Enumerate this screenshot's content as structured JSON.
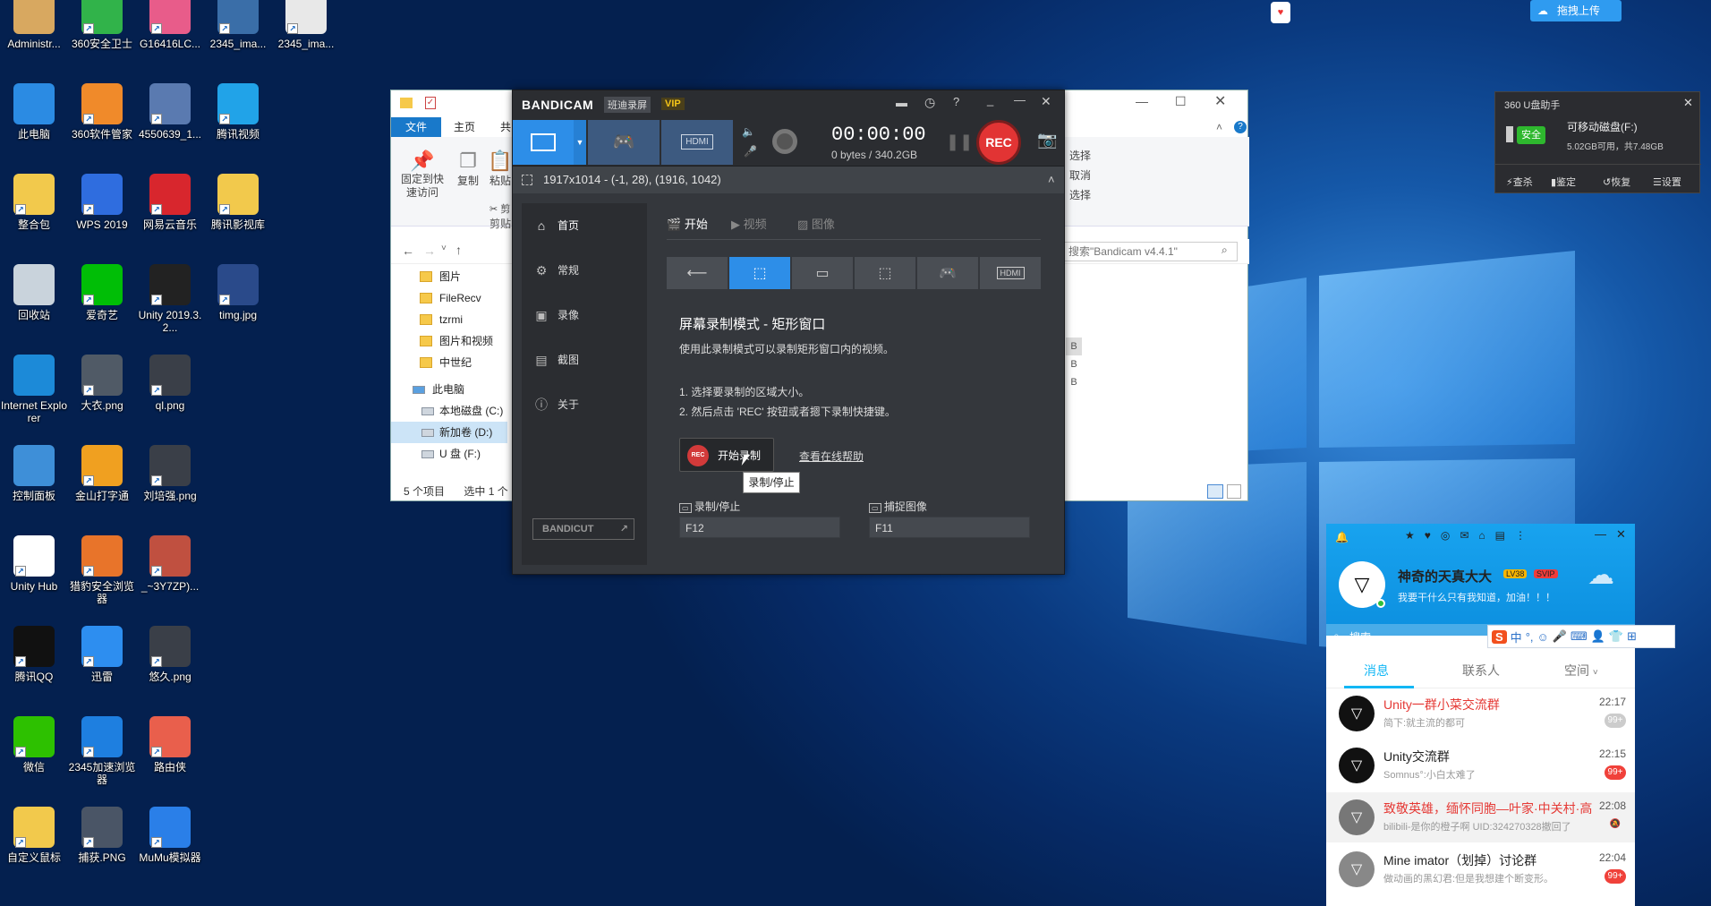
{
  "desktop": {
    "icons": [
      {
        "label": "Administr...",
        "color": "#d8a860"
      },
      {
        "label": "360安全卫士",
        "color": "#31b34a"
      },
      {
        "label": "G16416LC...",
        "color": "#e85c8a"
      },
      {
        "label": "2345_ima...",
        "color": "#3a6ea8"
      },
      {
        "label": "2345_ima...",
        "color": "#e8e8e8"
      },
      {
        "label": "此电脑",
        "color": "#2b8be3"
      },
      {
        "label": "360软件管家",
        "color": "#f08a2a"
      },
      {
        "label": "4550639_1...",
        "color": "#5a7ab0"
      },
      {
        "label": "腾讯视频",
        "color": "#21a3e8"
      },
      {
        "label": "整合包",
        "color": "#f2c94c"
      },
      {
        "label": "WPS 2019",
        "color": "#2f6ddf"
      },
      {
        "label": "网易云音乐",
        "color": "#d8262d"
      },
      {
        "label": "腾讯影视库",
        "color": "#f2c94c"
      },
      {
        "label": "回收站",
        "color": "#c9d3dc"
      },
      {
        "label": "爱奇艺",
        "color": "#00be06"
      },
      {
        "label": "Unity 2019.3.2...",
        "color": "#222222"
      },
      {
        "label": "timg.jpg",
        "color": "#2a4a8a"
      },
      {
        "label": "Internet Explorer",
        "color": "#1c8ad8"
      },
      {
        "label": "大衣.png",
        "color": "#505a66"
      },
      {
        "label": "ql.png",
        "color": "#3a3f48"
      },
      {
        "label": "控制面板",
        "color": "#3e8fd8"
      },
      {
        "label": "金山打字通",
        "color": "#f0a020"
      },
      {
        "label": "刘培强.png",
        "color": "#3a3f48"
      },
      {
        "label": "Unity Hub",
        "color": "#ffffff"
      },
      {
        "label": "猎豹安全浏览器",
        "color": "#e8742a"
      },
      {
        "label": "_~3Y7ZP)...",
        "color": "#c05040"
      },
      {
        "label": "腾讯QQ",
        "color": "#111111"
      },
      {
        "label": "迅雷",
        "color": "#2d8ef0"
      },
      {
        "label": "悠久.png",
        "color": "#3a3f48"
      },
      {
        "label": "微信",
        "color": "#2dc100"
      },
      {
        "label": "2345加速浏览器",
        "color": "#1e7fe0"
      },
      {
        "label": "路由侠",
        "color": "#e95f4c"
      },
      {
        "label": "自定义鼠标",
        "color": "#f2c94c"
      },
      {
        "label": "捕获.PNG",
        "color": "#4a5566"
      },
      {
        "label": "MuMu模拟器",
        "color": "#2a7fe8"
      }
    ],
    "upload_button": "拖拽上传"
  },
  "explorer": {
    "tab_file": "文件",
    "tab_home": "主页",
    "tab_share": "共",
    "ribbon": {
      "pin": "固定到快速访问",
      "copy": "复制",
      "paste": "粘贴",
      "cut": "剪",
      "clip": "剪贴",
      "select_all": "选择",
      "cancel_sel": "取消",
      "invert_sel": "选择"
    },
    "search_placeholder": "搜索\"Bandicam v4.4.1\"",
    "tree": [
      {
        "label": "图片",
        "type": "pic"
      },
      {
        "label": "FileRecv",
        "type": "folder"
      },
      {
        "label": "tzrmi",
        "type": "folder"
      },
      {
        "label": "图片和视频",
        "type": "folder"
      },
      {
        "label": "中世纪",
        "type": "folder"
      },
      {
        "label": "此电脑",
        "type": "pc"
      },
      {
        "label": "本地磁盘 (C:)",
        "type": "drive"
      },
      {
        "label": "新加卷 (D:)",
        "type": "drive"
      },
      {
        "label": "U 盘 (F:)",
        "type": "drive"
      }
    ],
    "sizes": [
      "B",
      "B",
      "B"
    ],
    "status_items": "5 个项目",
    "status_selected": "选中 1 个"
  },
  "bandicam": {
    "logo": "BANDICAM",
    "subtitle": "班迪录屏",
    "vip": "VIP",
    "timer": "00:00:00",
    "storage": "0 bytes / 340.2GB",
    "rec_label": "REC",
    "region": "1917x1014 - (-1, 28), (1916, 1042)",
    "sidebar": [
      "首页",
      "常规",
      "录像",
      "截图",
      "关于"
    ],
    "bandicut": "BANDICUT",
    "tabs": [
      "开始",
      "视频",
      "图像"
    ],
    "mode_title": "屏幕录制模式 - 矩形窗口",
    "mode_desc": "使用此录制模式可以录制矩形窗口内的视频。",
    "step1": "1. 选择要录制的区域大小。",
    "step2": "2. 然后点击 'REC' 按钮或者摁下录制快捷键。",
    "start_rec": "开始录制",
    "rec_small": "REC",
    "help_link": "查看在线帮助",
    "tooltip": "录制/停止",
    "hotkey_rec_label": "录制/停止",
    "hotkey_rec": "F12",
    "hotkey_cap_label": "捕捉图像",
    "hotkey_cap": "F11"
  },
  "p360": {
    "title": "360 U盘助手",
    "safe": "安全",
    "drive": "可移动磁盘(F:)",
    "space": "5.02GB可用，共7.48GB",
    "actions": [
      "查杀",
      "鉴定",
      "恢复",
      "设置"
    ]
  },
  "qq": {
    "nickname": "神奇的天真大大",
    "vip": "LV38",
    "svip": "SVIP",
    "signature": "我要干什么只有我知道，加油！！！",
    "search": "搜索",
    "tabs": [
      "消息",
      "联系人",
      "空间"
    ],
    "chats": [
      {
        "name": "Unity一群小菜交流群",
        "msg": "简下:就主流的都可",
        "time": "22:17",
        "badge": "99+",
        "red": true,
        "gray": true
      },
      {
        "name": "Unity交流群",
        "msg": "Somnus°:小白太难了",
        "time": "22:15",
        "badge": "99+",
        "red": false,
        "gray": false
      },
      {
        "name": "致敬英雄，缅怀同胞—叶家·中关村·高",
        "msg": "bilibili-是你的橙子啊 UID:324270328撤回了",
        "time": "22:08",
        "badge": "",
        "red": true,
        "gray": true
      },
      {
        "name": "Mine imator（划掉）讨论群",
        "msg": "做动画的黑幻君:但是我想建个断变形。",
        "time": "22:04",
        "badge": "99+",
        "red": false,
        "gray": false
      }
    ],
    "ime": [
      "S",
      "中",
      "°,",
      "☺",
      "🎤",
      "⌨",
      "👤",
      "👕",
      "⊞"
    ]
  }
}
